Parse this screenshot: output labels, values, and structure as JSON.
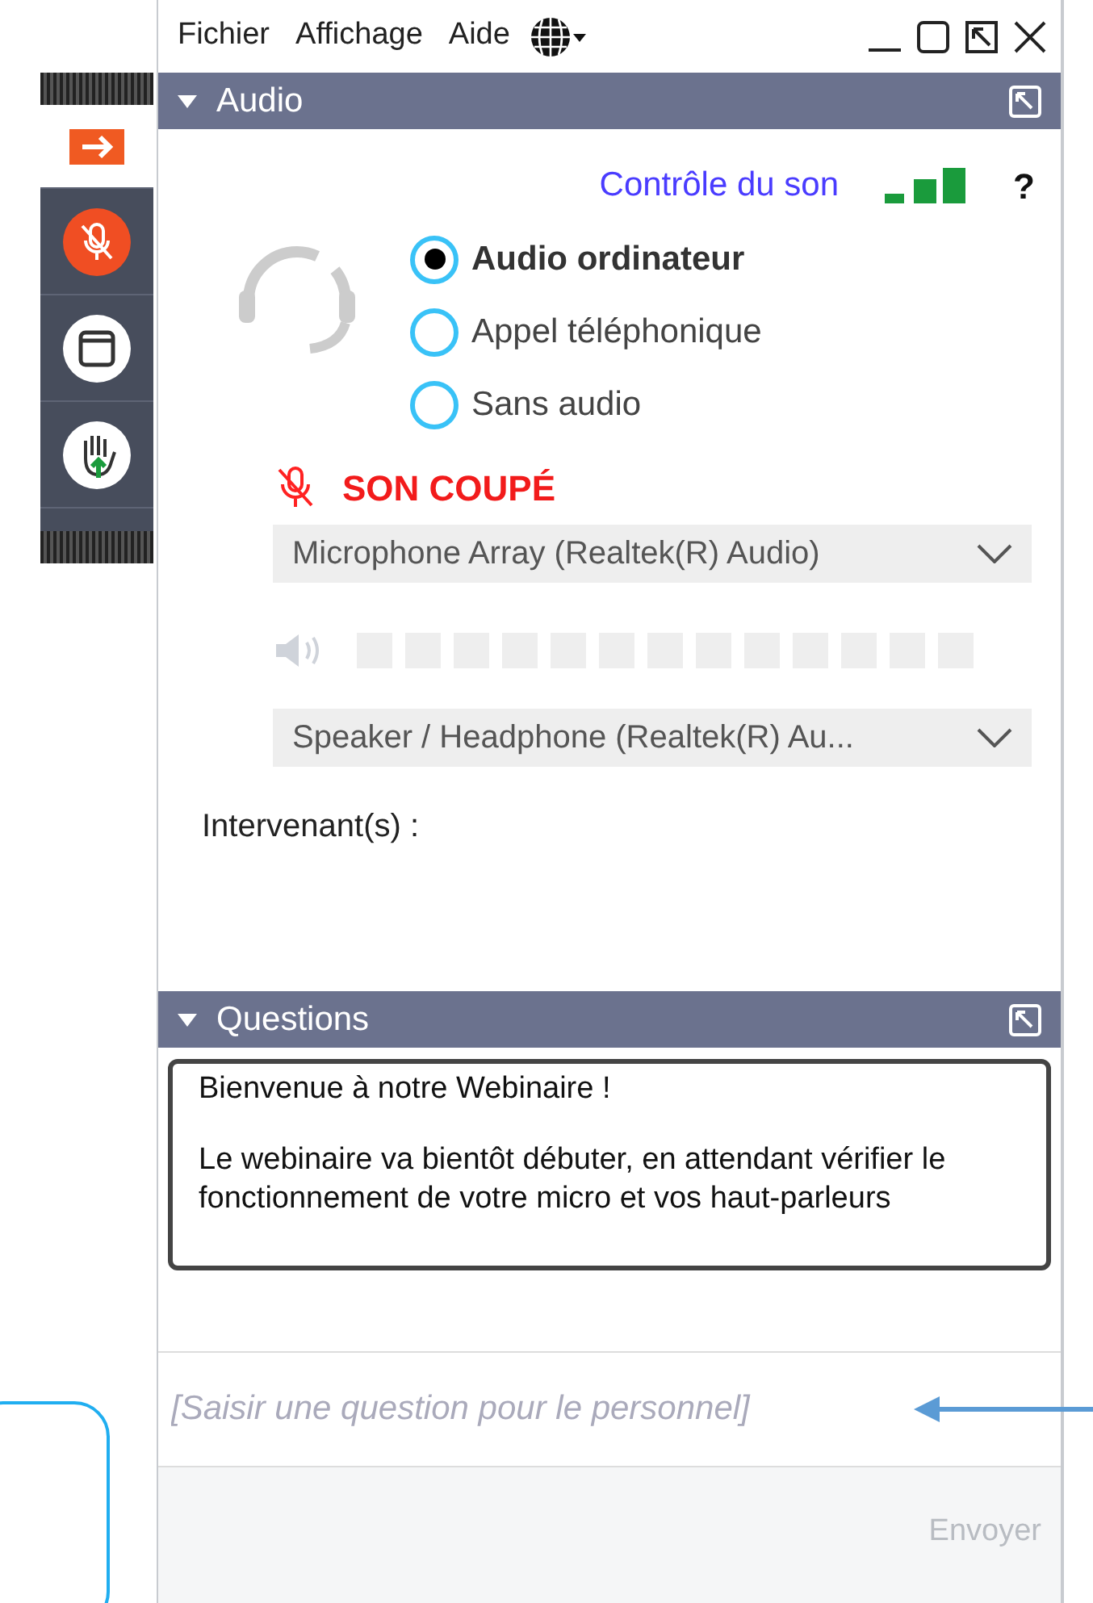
{
  "menu": [
    "Fichier",
    "Affichage",
    "Aide"
  ],
  "sidebar": {
    "items": [
      {
        "kind": "arrow",
        "selected": true
      },
      {
        "kind": "mic",
        "selected": false
      },
      {
        "kind": "window",
        "selected": false
      },
      {
        "kind": "hand",
        "selected": false
      }
    ]
  },
  "audio": {
    "title": "Audio",
    "sound_check": "Contrôle du son",
    "help": "?",
    "options": [
      {
        "label": "Audio ordinateur",
        "selected": true
      },
      {
        "label": "Appel téléphonique",
        "selected": false
      },
      {
        "label": "Sans audio",
        "selected": false
      }
    ],
    "mute_status": "SON COUPÉ",
    "microphone": "Microphone Array (Realtek(R) Audio)",
    "speaker": "Speaker / Headphone (Realtek(R) Au...",
    "speakers_label": "Intervenant(s) :"
  },
  "questions": {
    "title": "Questions",
    "welcome": "Bienvenue à notre Webinaire !",
    "message": "Le webinaire va bientôt débuter, en attendant vérifier le fonctionnement de votre micro et vos haut-parleurs",
    "placeholder": "[Saisir une question pour le personnel]",
    "send": "Envoyer"
  }
}
